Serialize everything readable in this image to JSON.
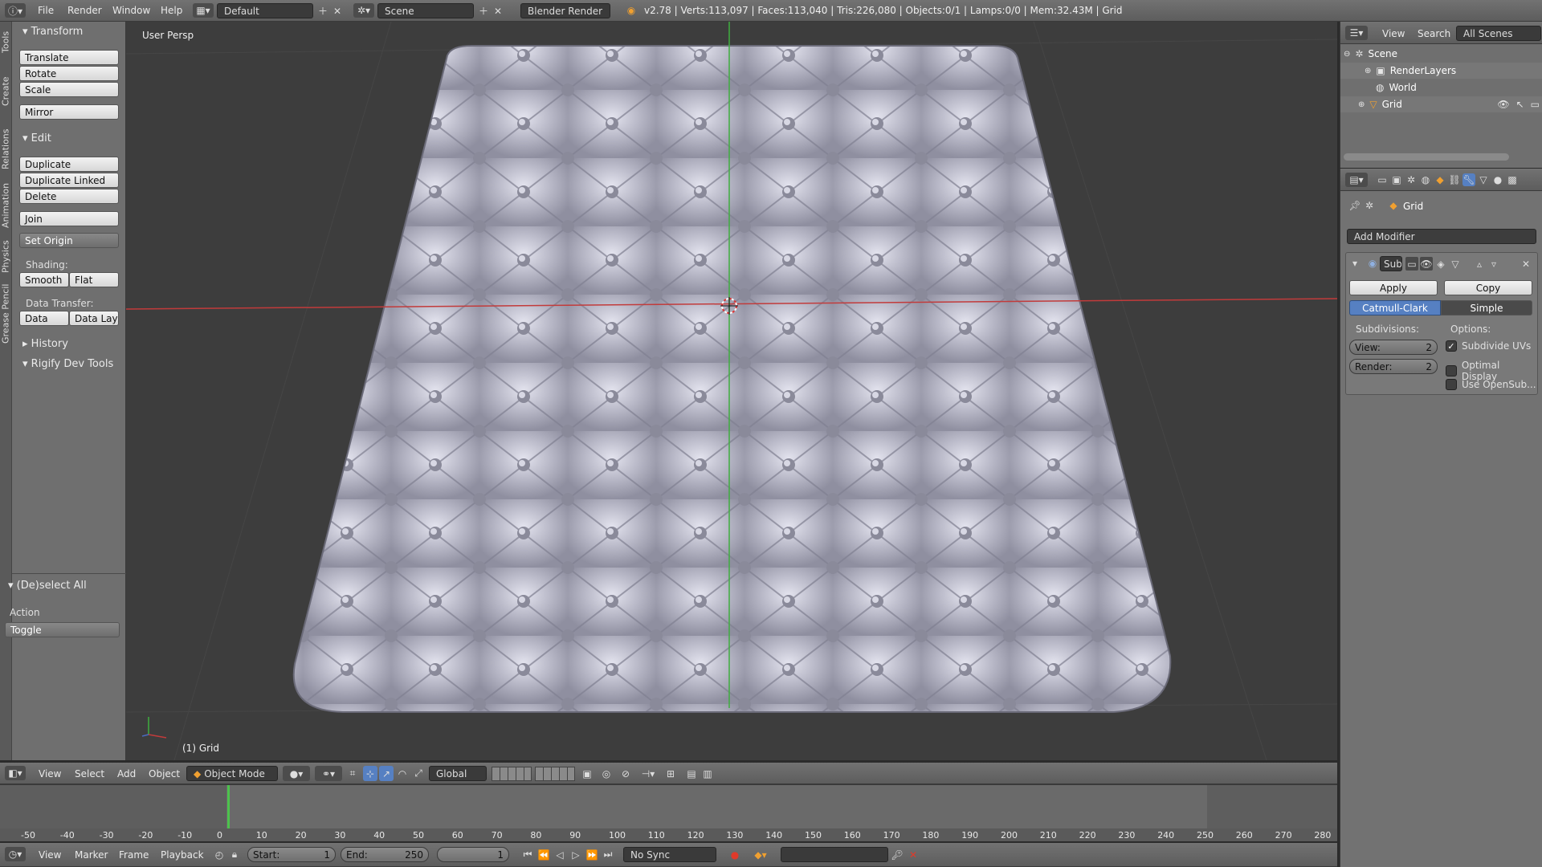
{
  "topbar": {
    "menus": [
      "File",
      "Render",
      "Window",
      "Help"
    ],
    "layout": "Default",
    "scene": "Scene",
    "engine": "Blender Render",
    "stats": "v2.78 | Verts:113,097 | Faces:113,040 | Tris:226,080 | Objects:0/1 | Lamps:0/0 | Mem:32.43M | Grid"
  },
  "toolshelf": {
    "vertical_tabs": [
      "Tools",
      "Create",
      "Relations",
      "Animation",
      "Physics",
      "Grease Pencil"
    ],
    "transform": {
      "title": "Transform",
      "buttons": [
        "Translate",
        "Rotate",
        "Scale",
        "Mirror"
      ]
    },
    "edit": {
      "title": "Edit",
      "buttons": [
        "Duplicate",
        "Duplicate Linked",
        "Delete",
        "Join"
      ],
      "set_origin": "Set Origin"
    },
    "shading": {
      "label": "Shading:",
      "smooth": "Smooth",
      "flat": "Flat"
    },
    "data_transfer": {
      "label": "Data Transfer:",
      "data": "Data",
      "data_layout": "Data Layo"
    },
    "history": "History",
    "rigify": "Rigify Dev Tools",
    "operator": {
      "title": "(De)select All",
      "action_label": "Action",
      "action_value": "Toggle"
    }
  },
  "viewport": {
    "view_name": "User Persp",
    "object_label": "(1) Grid",
    "header": {
      "menus": [
        "View",
        "Select",
        "Add",
        "Object"
      ],
      "mode": "Object Mode",
      "orientation": "Global"
    }
  },
  "timeline": {
    "ticks": [
      "-50",
      "-40",
      "-30",
      "-20",
      "-10",
      "0",
      "10",
      "20",
      "30",
      "40",
      "50",
      "60",
      "70",
      "80",
      "90",
      "100",
      "110",
      "120",
      "130",
      "140",
      "150",
      "160",
      "170",
      "180",
      "190",
      "200",
      "210",
      "220",
      "230",
      "240",
      "250",
      "260",
      "270",
      "280"
    ],
    "current_frame_value": 1,
    "menus": [
      "View",
      "Marker",
      "Frame",
      "Playback"
    ],
    "start_label": "Start:",
    "start_value": "1",
    "end_label": "End:",
    "end_value": "250",
    "current_frame": "1",
    "sync": "No Sync"
  },
  "outliner": {
    "menus": [
      "View",
      "Search"
    ],
    "filter": "All Scenes",
    "items": [
      "Scene",
      "RenderLayers",
      "World",
      "Grid"
    ]
  },
  "properties": {
    "breadcrumb": "Grid",
    "add_modifier": "Add Modifier",
    "modifier_name": "Sub",
    "apply": "Apply",
    "copy": "Copy",
    "catmull": "Catmull-Clark",
    "simple": "Simple",
    "subdivisions_label": "Subdivisions:",
    "options_label": "Options:",
    "view_label": "View:",
    "view_value": "2",
    "render_label": "Render:",
    "render_value": "2",
    "opt1": "Subdivide UVs",
    "opt2": "Optimal Display",
    "opt3": "Use OpenSub..."
  },
  "colors": {
    "accent_blue": "#5680c2",
    "x_axis": "#c23b3b",
    "y_axis": "#3fae3f",
    "frame_marker": "#4cc24c"
  }
}
